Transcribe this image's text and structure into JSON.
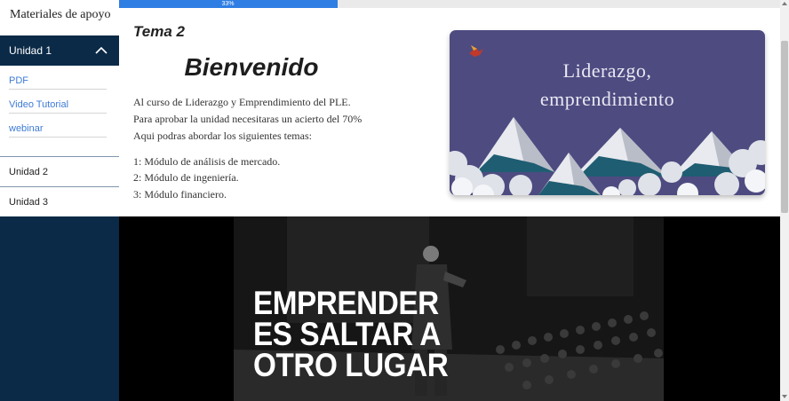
{
  "sidebar": {
    "header": "Materiales de apoyo",
    "unit1": {
      "label": "Unidad 1",
      "expanded": true
    },
    "links": [
      "PDF",
      "Video Tutorial",
      "webinar"
    ],
    "units": [
      "Unidad 2",
      "Unidad 3"
    ]
  },
  "progress": {
    "percent": 33,
    "label": "33%"
  },
  "main": {
    "tema": "Tema 2",
    "welcome": "Bienvenido",
    "intro": [
      "Al curso de Liderazgo y Emprendimiento del PLE.",
      "Para aprobar la unidad necesitaras un acierto del 70%",
      "Aqui podras abordar los siguientes temas:"
    ],
    "topics": [
      "1: Módulo de análisis de mercado.",
      "2: Módulo de ingeniería.",
      "3: Módulo financiero."
    ]
  },
  "banner": {
    "line1": "Liderazgo,",
    "line2": "emprendimiento",
    "icon": "bird-icon"
  },
  "video": {
    "overlay": [
      "EMPRENDER",
      "ES SALTAR A",
      "OTRO LUGAR"
    ]
  },
  "colors": {
    "sidebar": "#0b2a47",
    "link": "#3d7bd6",
    "progress": "#2f7ee3",
    "banner": "#4e4b81"
  }
}
